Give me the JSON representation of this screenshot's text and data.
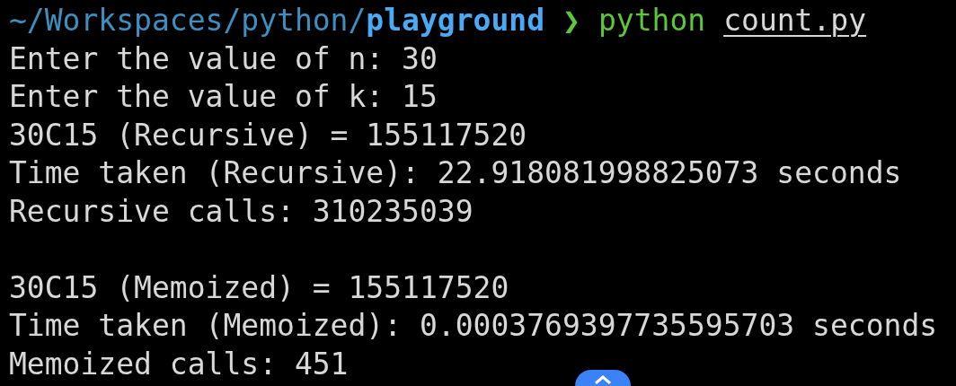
{
  "prompt": {
    "path": "~/Workspaces/python/",
    "directory": "playground",
    "symbol": "❯",
    "command": "python",
    "argument": "count.py"
  },
  "output_blocks": [
    [
      "Enter the value of n: 30",
      "Enter the value of k: 15",
      "30C15 (Recursive) = 155117520",
      "Time taken (Recursive): 22.918081998825073 seconds",
      "Recursive calls: 310235039"
    ],
    [
      "30C15 (Memoized) = 155117520",
      "Time taken (Memoized): 0.0003769397735595703 seconds",
      "Memoized calls: 451"
    ]
  ]
}
